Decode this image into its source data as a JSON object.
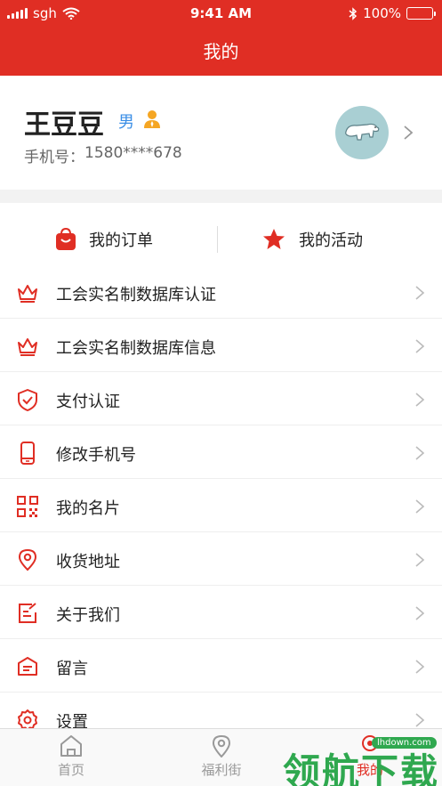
{
  "status": {
    "carrier": "sgh",
    "time": "9:41 AM",
    "battery": "100%"
  },
  "nav": {
    "title": "我的"
  },
  "profile": {
    "name": "王豆豆",
    "gender": "男",
    "phone_label": "手机号：",
    "phone": "1580****678"
  },
  "quick": [
    {
      "label": "我的订单",
      "icon": "shopping-bag-icon"
    },
    {
      "label": "我的活动",
      "icon": "star-icon"
    }
  ],
  "menu": [
    {
      "label": "工会实名制数据库认证",
      "icon": "crown-icon"
    },
    {
      "label": "工会实名制数据库信息",
      "icon": "crown-icon"
    },
    {
      "label": "支付认证",
      "icon": "shield-check-icon"
    },
    {
      "label": "修改手机号",
      "icon": "phone-icon"
    },
    {
      "label": "我的名片",
      "icon": "qr-code-icon"
    },
    {
      "label": "收货地址",
      "icon": "location-pin-icon"
    },
    {
      "label": "关于我们",
      "icon": "edit-note-icon"
    },
    {
      "label": "留言",
      "icon": "message-icon"
    },
    {
      "label": "设置",
      "icon": "gear-icon"
    }
  ],
  "tabs": [
    {
      "label": "首页",
      "icon": "home-icon"
    },
    {
      "label": "福利街",
      "icon": "location-pin-icon"
    },
    {
      "label": "我的",
      "icon": "user-icon"
    }
  ],
  "watermark": {
    "text": "领航下载",
    "url": "lhdown.com"
  },
  "colors": {
    "brand": "#e02e24",
    "gender": "#3a8ee6",
    "badge": "#f5a623",
    "avatar_bg": "#a9cfd3"
  }
}
